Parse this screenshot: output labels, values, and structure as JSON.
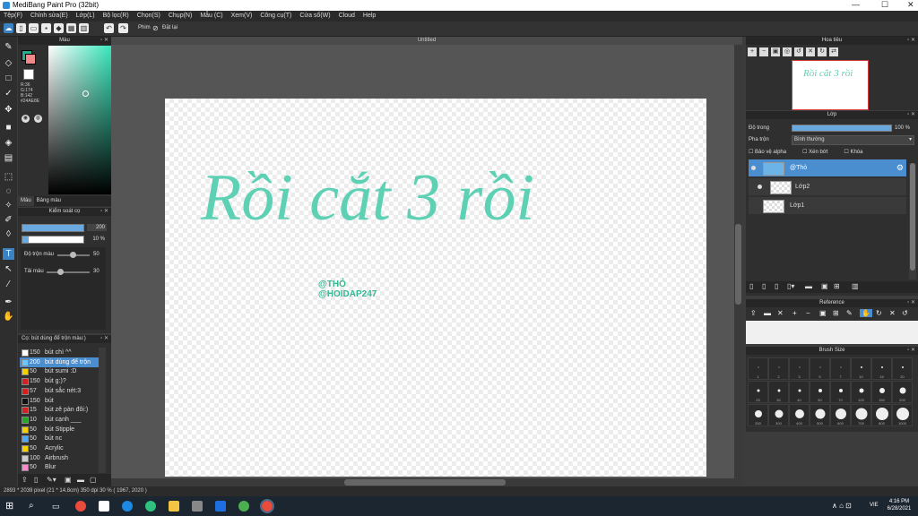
{
  "app": {
    "title": "MediBang Paint Pro (32bit)",
    "window_controls": [
      "—",
      "☐",
      "✕"
    ]
  },
  "menu": [
    "Tệp(F)",
    "Chỉnh sửa(E)",
    "Lớp(L)",
    "Bộ lọc(R)",
    "Chọn(S)",
    "Chụp(N)",
    "Mẫu (C)",
    "Xem(V)",
    "Công cụ(T)",
    "Cửa sổ(W)",
    "Cloud",
    "Help"
  ],
  "toolbar": {
    "mode_label": "Phim",
    "undo_label": "Đặt lại"
  },
  "color_panel": {
    "title": "Màu",
    "rgb": [
      "R:36",
      "G:174",
      "B:142"
    ],
    "hex": "#24AE8E",
    "tabs": [
      "Màu",
      "Bảng màu"
    ]
  },
  "brush_settings": {
    "title": "Kiểm soát cọ",
    "size_value": "200",
    "opacity_value": "10 %",
    "size_fill": 1.0,
    "opacity_fill": 0.1,
    "blend_label": "Độ trộn màu",
    "blend_value": "50",
    "reload_label": "Tải màu",
    "reload_value": "30"
  },
  "brush_list": {
    "title": "Cọ: bút dùng để trộn màu:)",
    "items": [
      {
        "size": "150",
        "name": "bút chì ^^",
        "color": "#ffffff"
      },
      {
        "size": "200",
        "name": "bút dùng để trộn",
        "color": "#6cc6ff",
        "selected": true
      },
      {
        "size": "50",
        "name": "bút sumi :D",
        "color": "#f5d000"
      },
      {
        "size": "150",
        "name": "bút g:)?",
        "color": "#d42020"
      },
      {
        "size": "57",
        "name": "bút sắc nét:3",
        "color": "#d42020"
      },
      {
        "size": "150",
        "name": "bút",
        "color": "#111111"
      },
      {
        "size": "15",
        "name": "bút zê pàn đôi:)",
        "color": "#d42020"
      },
      {
        "size": "10",
        "name": "bút cạnh ___",
        "color": "#22aa22"
      },
      {
        "size": "50",
        "name": "bút Stipple",
        "color": "#f5d000"
      },
      {
        "size": "50",
        "name": "bút nc",
        "color": "#4aa8ff"
      },
      {
        "size": "50",
        "name": "Acrylic",
        "color": "#f5d000"
      },
      {
        "size": "100",
        "name": "Airbrush",
        "color": "#cccccc"
      },
      {
        "size": "50",
        "name": "Blur",
        "color": "#ff88cc"
      }
    ]
  },
  "document": {
    "tab_label": "Untitled",
    "art_text": "Rồi cắt 3 rồi",
    "watermark_line1": "@THỎ",
    "watermark_line2": "@HOIDAP247"
  },
  "navigator": {
    "title": "Hoa tiêu"
  },
  "layers": {
    "title": "Lớp",
    "opacity_label": "Độ trong",
    "opacity_value": "100 %",
    "opacity_fill": 1.0,
    "blend_label": "Pha trộn",
    "blend_value": "Bình thường",
    "protect_alpha": "Bảo vệ alpha",
    "clip": "Xén bớt",
    "lock": "Khóa",
    "items": [
      {
        "name": "@Thỏ",
        "selected": true
      },
      {
        "name": "Lớp2",
        "selected": false
      },
      {
        "name": "Lớp1",
        "selected": false
      }
    ]
  },
  "reference": {
    "title": "Reference"
  },
  "brush_size_panel": {
    "title": "Brush Size",
    "sizes": [
      "1",
      "2",
      "3",
      "5",
      "7",
      "10",
      "15",
      "20",
      "25",
      "30",
      "40",
      "50",
      "70",
      "100",
      "150",
      "200",
      "250",
      "300",
      "400",
      "500",
      "600",
      "700",
      "800",
      "1000"
    ]
  },
  "status": {
    "text": "2893 * 2039 pixel  (21 * 14.8cm)  350 dpi  30 %  ( 1967, 2020 )"
  },
  "taskbar": {
    "language": "VIE",
    "time": "4:16 PM",
    "date": "6/28/2021"
  }
}
